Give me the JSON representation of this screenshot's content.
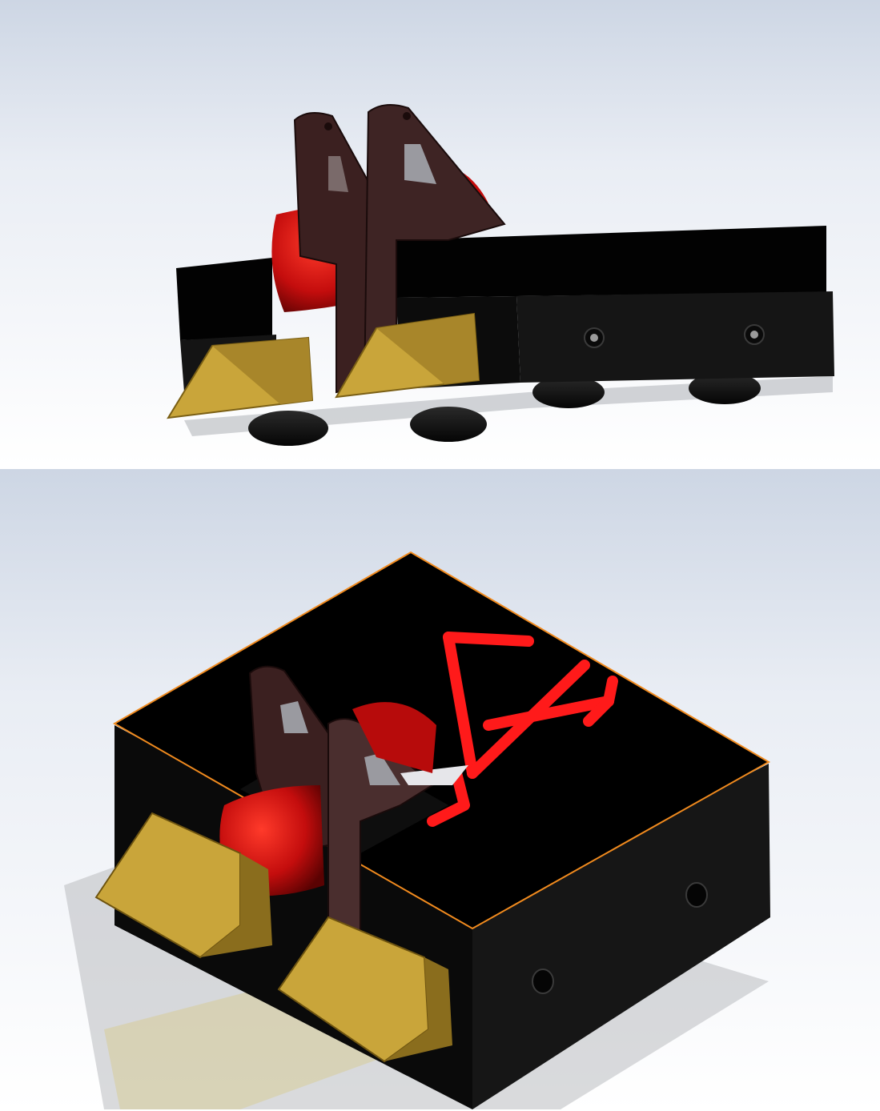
{
  "views": [
    {
      "name": "side-view",
      "label": ""
    },
    {
      "name": "isometric-view",
      "label": ""
    }
  ],
  "colors": {
    "body": "#050505",
    "body_side": "#141414",
    "wedge": "#c9a53a",
    "wedge_dark": "#8a6d1d",
    "weapon_drum": "#c40d0d",
    "weapon_drum_dark": "#6e0303",
    "lifter_arm": "#3e2424",
    "decal": "#ff1a1a",
    "edge_highlight": "#f08a1e"
  },
  "icons": {
    "decal": "brand-of-sacrifice-icon"
  }
}
